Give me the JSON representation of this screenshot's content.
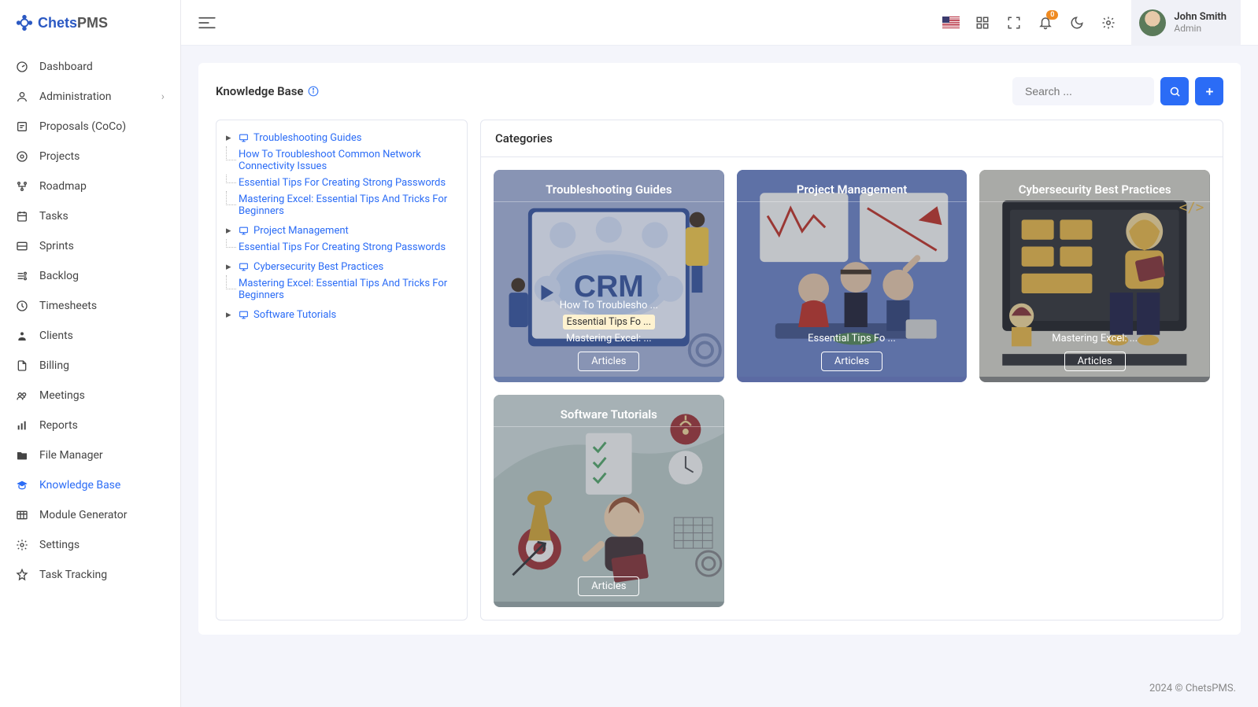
{
  "logo": {
    "brand_a": "Chets",
    "brand_b": "PMS"
  },
  "sidebar": {
    "items": [
      {
        "label": "Dashboard"
      },
      {
        "label": "Administration",
        "expandable": true
      },
      {
        "label": "Proposals (CoCo)"
      },
      {
        "label": "Projects"
      },
      {
        "label": "Roadmap"
      },
      {
        "label": "Tasks"
      },
      {
        "label": "Sprints"
      },
      {
        "label": "Backlog"
      },
      {
        "label": "Timesheets"
      },
      {
        "label": "Clients"
      },
      {
        "label": "Billing"
      },
      {
        "label": "Meetings"
      },
      {
        "label": "Reports"
      },
      {
        "label": "File Manager"
      },
      {
        "label": "Knowledge Base",
        "active": true
      },
      {
        "label": "Module Generator"
      },
      {
        "label": "Settings"
      },
      {
        "label": "Task Tracking"
      }
    ]
  },
  "topbar": {
    "notification_badge": "0",
    "user": {
      "name": "John Smith",
      "role": "Admin"
    }
  },
  "page": {
    "title": "Knowledge Base",
    "search_placeholder": "Search ..."
  },
  "tree": [
    {
      "name": "Troubleshooting Guides",
      "children": [
        {
          "name": "How To Troubleshoot Common Network Connectivity Issues"
        },
        {
          "name": "Essential Tips For Creating Strong Passwords"
        },
        {
          "name": "Mastering Excel: Essential Tips And Tricks For Beginners"
        }
      ]
    },
    {
      "name": "Project Management",
      "children": [
        {
          "name": "Essential Tips For Creating Strong Passwords"
        }
      ]
    },
    {
      "name": "Cybersecurity Best Practices",
      "children": [
        {
          "name": "Mastering Excel: Essential Tips And Tricks For Beginners"
        }
      ]
    },
    {
      "name": "Software Tutorials",
      "children": []
    }
  ],
  "categories_title": "Categories",
  "cards": [
    {
      "title": "Troubleshooting Guides",
      "bg": "bg-crm",
      "links": [
        {
          "text": "How To Troublesho ..."
        },
        {
          "text": "Essential Tips Fo ...",
          "hl": true
        },
        {
          "text": "Mastering Excel: ..."
        }
      ],
      "button": "Articles"
    },
    {
      "title": "Project Management",
      "bg": "bg-pm",
      "links": [
        {
          "text": "Essential Tips Fo ..."
        }
      ],
      "button": "Articles"
    },
    {
      "title": "Cybersecurity Best Practices",
      "bg": "bg-cyber",
      "links": [
        {
          "text": "Mastering Excel: ..."
        }
      ],
      "button": "Articles"
    },
    {
      "title": "Software Tutorials",
      "bg": "bg-soft",
      "links": [],
      "button": "Articles"
    }
  ],
  "footer": "2024 © ChetsPMS."
}
